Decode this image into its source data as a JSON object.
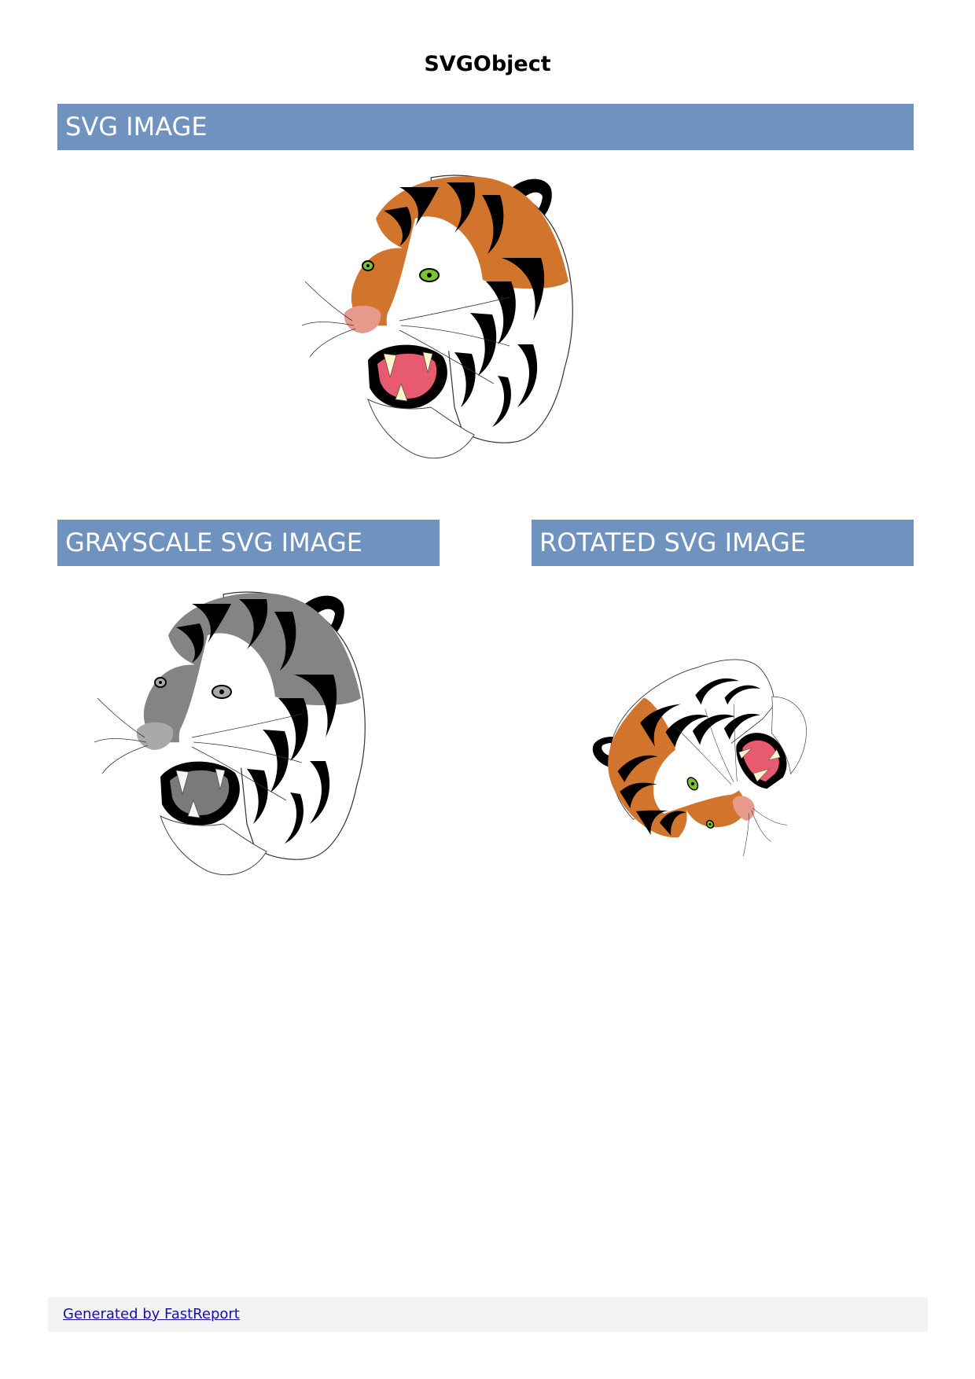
{
  "page": {
    "title": "SVGObject"
  },
  "sections": {
    "svg_image": {
      "label": "SVG IMAGE"
    },
    "grayscale_svg_image": {
      "label": "GRAYSCALE SVG IMAGE"
    },
    "rotated_svg_image": {
      "label": "ROTATED SVG IMAGE"
    }
  },
  "footer": {
    "link_text": "Generated by FastReport"
  },
  "colors": {
    "band_background": "#7092bf",
    "band_text": "#ffffff",
    "footer_background": "#f3f3f3",
    "footer_link": "#1a0dab",
    "tiger_orange": "#d2752c",
    "tiger_black": "#000000",
    "tiger_white": "#ffffff",
    "tiger_eye": "#7ac52b",
    "tiger_mouth": "#e85a70",
    "tiger_nose": "#e79a8c",
    "tiger_fang": "#fff7c9"
  },
  "images": {
    "color_icon": "tiger-head-icon",
    "grayscale_icon": "tiger-head-grayscale-icon",
    "rotated_icon": "tiger-head-rotated-icon"
  }
}
